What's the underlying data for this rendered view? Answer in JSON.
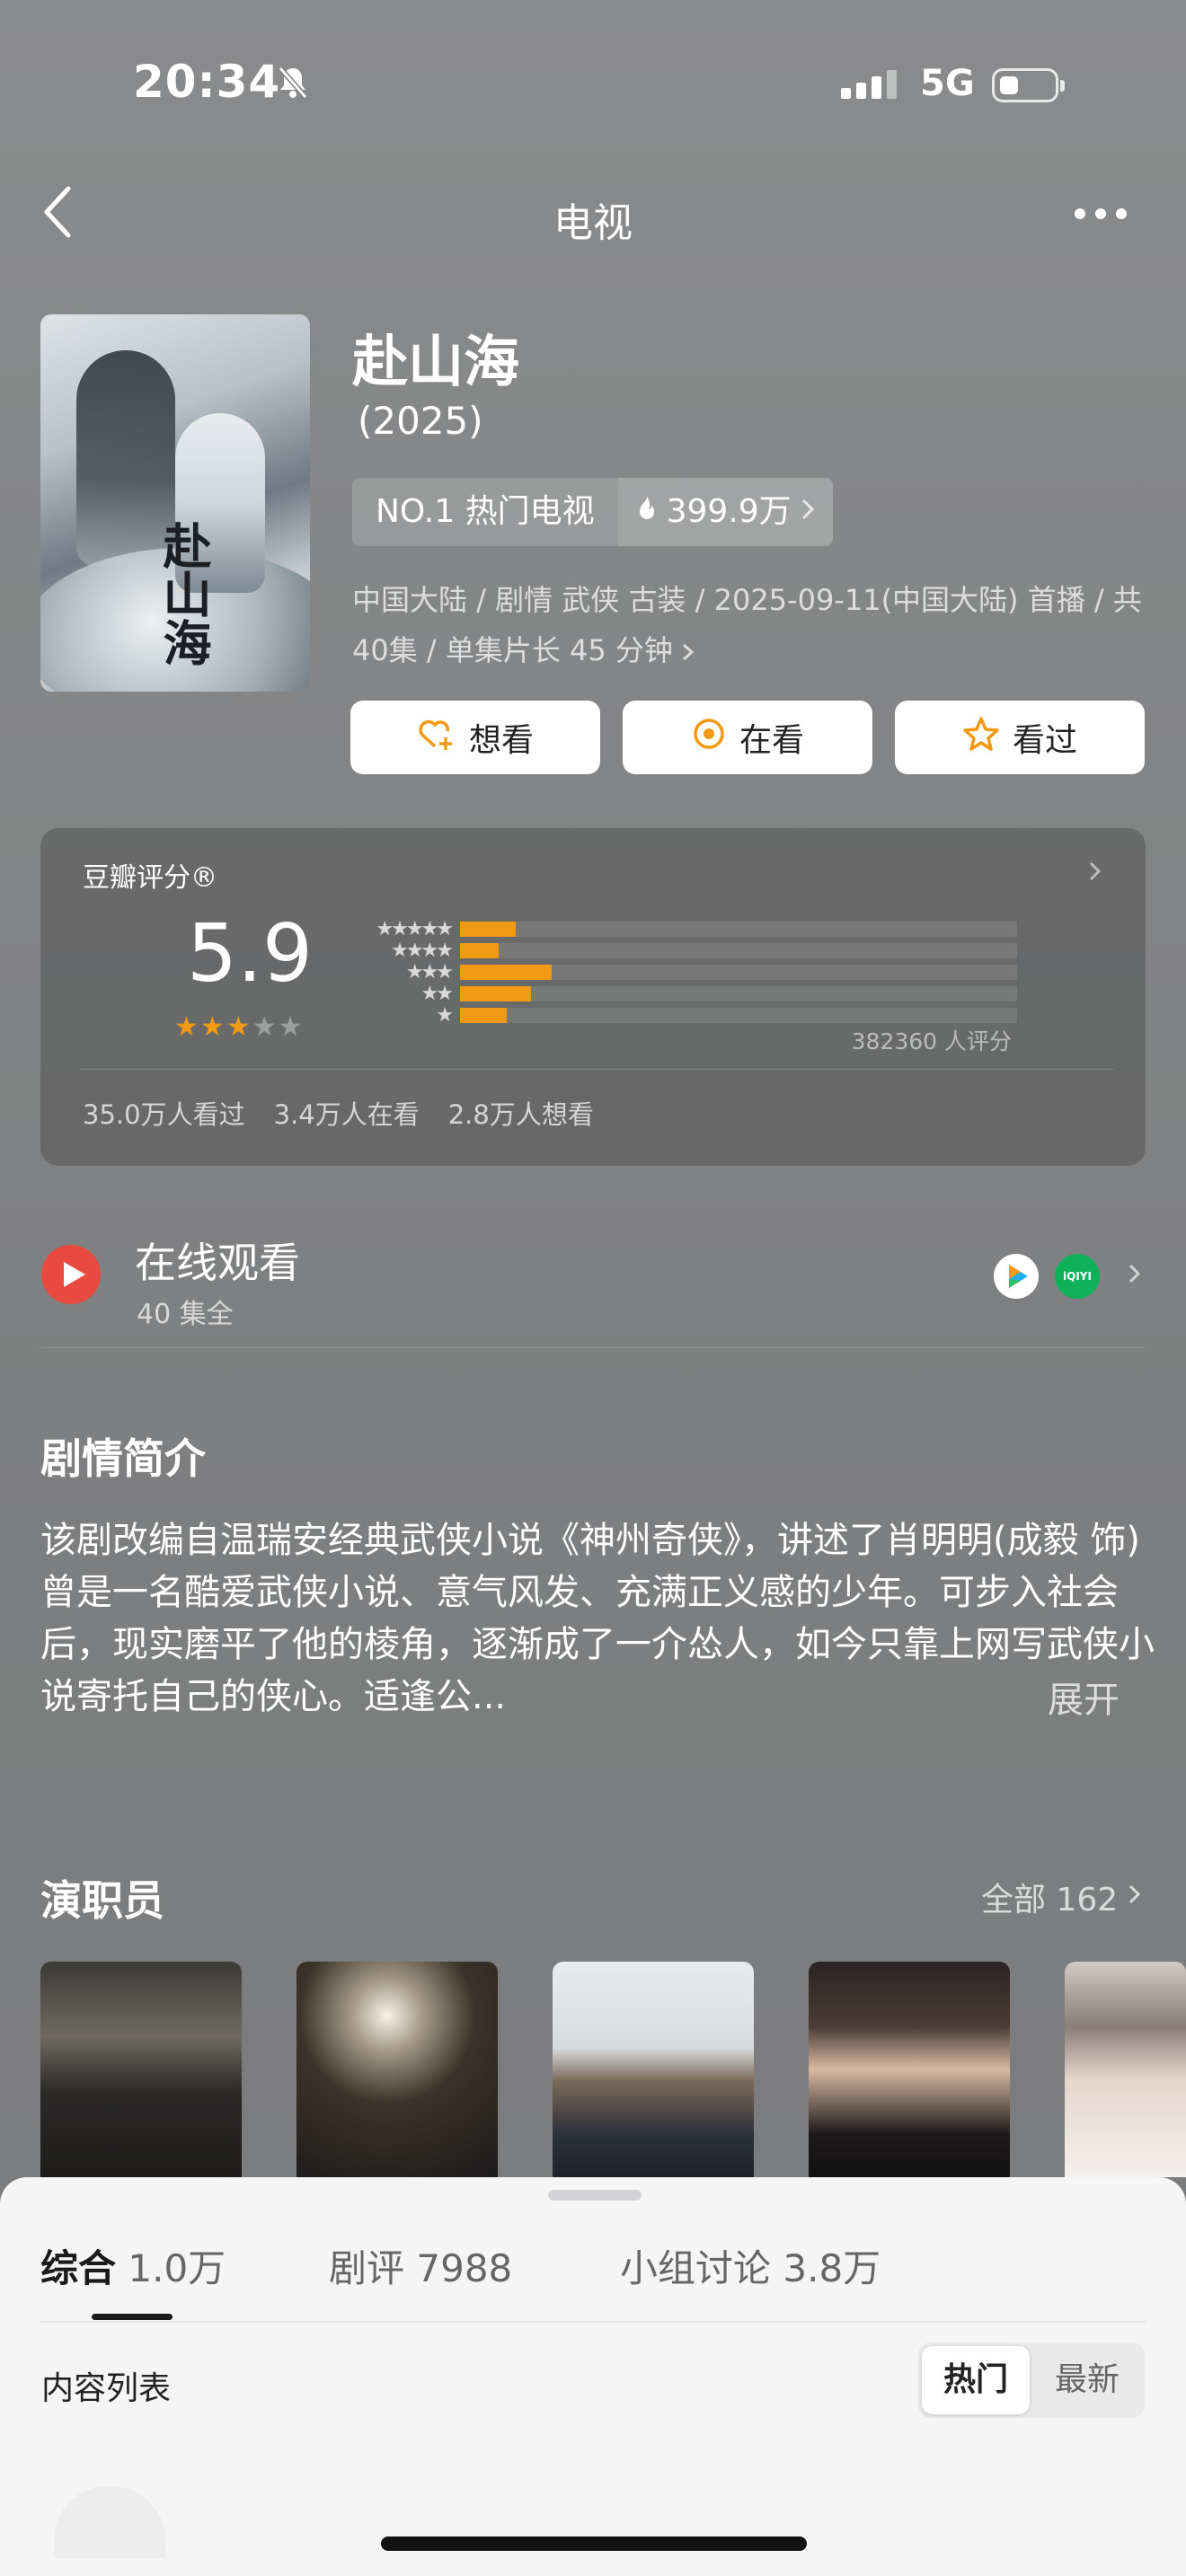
{
  "status_bar": {
    "time": "20:34",
    "network": "5G"
  },
  "nav": {
    "title": "电视"
  },
  "movie": {
    "title": "赴山海",
    "year": "(2025)",
    "poster_title": "赴山海",
    "rank": "NO.1 热门电视",
    "heat": "399.9万",
    "meta": "中国大陆 / 剧情 武侠 古装 / 2025-09-11(中国大陆) 首播 / 共40集 / 单集片长 45 分钟"
  },
  "actions": [
    {
      "label": "想看",
      "icon": "heart-plus-icon"
    },
    {
      "label": "在看",
      "icon": "watching-icon"
    },
    {
      "label": "看过",
      "icon": "star-outline-icon"
    }
  ],
  "rating": {
    "label": "豆瓣评分®",
    "score": "5.9",
    "stars_filled": 3,
    "stars_total": 5,
    "count": "382360 人评分",
    "stats": [
      "35.0万人看过",
      "3.4万人在看",
      "2.8万人想看"
    ],
    "distribution": [
      {
        "stars": "★★★★★",
        "fraction": 0.1
      },
      {
        "stars": "★★★★",
        "fraction": 0.07
      },
      {
        "stars": "★★★",
        "fraction": 0.165
      },
      {
        "stars": "★★",
        "fraction": 0.127
      },
      {
        "stars": "★",
        "fraction": 0.084
      }
    ],
    "bar_color": "#f09a13"
  },
  "watch": {
    "title": "在线观看",
    "subtitle": "40 集全",
    "apps": [
      "tencent-video-icon",
      "iqiyi-icon"
    ],
    "iqiyi_text": "iQIYI"
  },
  "synopsis": {
    "heading": "剧情简介",
    "text": "该剧改编自温瑞安经典武侠小说《神州奇侠》，讲述了肖明明(成毅 饰) 曾是一名酷爱武侠小说、意气风发、充满正义感的少年。可步入社会后，现实磨平了他的棱角，逐渐成了一介怂人，如今只靠上网写武侠小说寄托自己的侠心。适逢公...",
    "expand": "展开"
  },
  "cast": {
    "heading": "演职员",
    "all_label": "全部 162"
  },
  "sheet": {
    "tabs": [
      {
        "label": "综合",
        "count": "1.0万"
      },
      {
        "label": "剧评",
        "count": "7988"
      },
      {
        "label": "小组讨论",
        "count": "3.8万"
      }
    ],
    "list_title": "内容列表",
    "sort_hot": "热门",
    "sort_new": "最新"
  }
}
